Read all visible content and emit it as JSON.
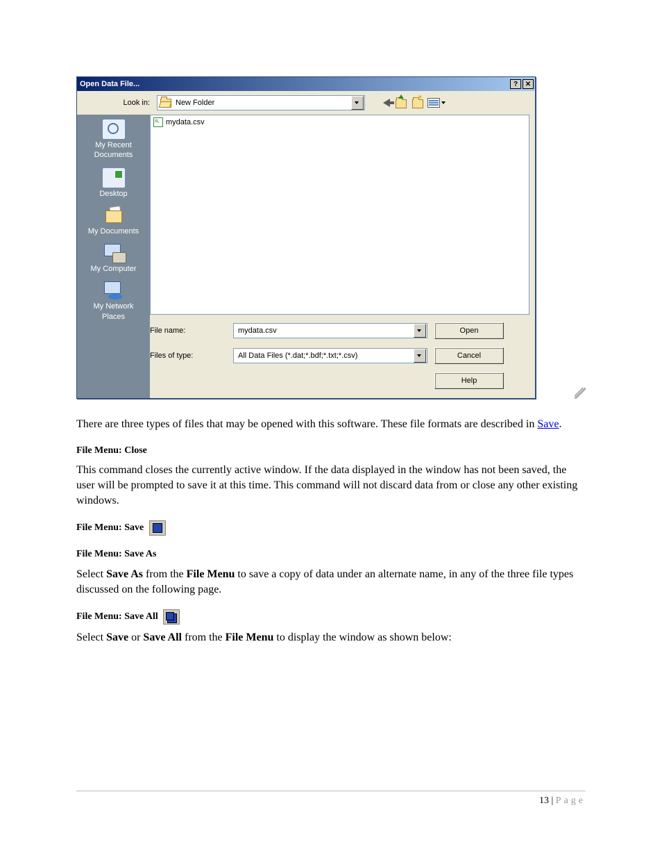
{
  "dialog": {
    "title": "Open Data File...",
    "help_glyph": "?",
    "close_glyph": "✕",
    "lookin_label": "Look in:",
    "lookin_value": "New Folder",
    "places": [
      {
        "label": "My Recent\nDocuments",
        "icon": "docs"
      },
      {
        "label": "Desktop",
        "icon": "desktop"
      },
      {
        "label": "My Documents",
        "icon": "mydocs"
      },
      {
        "label": "My Computer",
        "icon": "computer"
      },
      {
        "label": "My Network\nPlaces",
        "icon": "network"
      }
    ],
    "files": [
      {
        "name": "mydata.csv"
      }
    ],
    "filename_label": "File name:",
    "filename_value": "mydata.csv",
    "filetype_label": "Files of type:",
    "filetype_value": "All Data Files (*.dat;*.bdf;*.txt;*.csv)",
    "buttons": {
      "open": "Open",
      "cancel": "Cancel",
      "help": "Help"
    }
  },
  "doc": {
    "p1a": "There are three types of files that may be opened with this software. These file formats are described in ",
    "p1_link": "Save",
    "p1b": ".",
    "h_close": "File Menu: Close",
    "p_close": "This command closes the currently active window. If the data displayed in the window has not been saved, the user will be prompted to save it at this time. This command will not discard data from or close any other existing windows.",
    "h_save": "File Menu: Save",
    "h_saveas": "File Menu: Save As",
    "p_saveas_a": "Select ",
    "p_saveas_b": "Save As",
    "p_saveas_c": " from the ",
    "p_saveas_d": "File Menu",
    "p_saveas_e": " to save a copy of data under an alternate name, in any of the three file types discussed on the following page.",
    "h_saveall": "File Menu: Save All",
    "p_saveall_a": "Select ",
    "p_saveall_b": "Save",
    "p_saveall_c": " or ",
    "p_saveall_d": "Save All",
    "p_saveall_e": " from the ",
    "p_saveall_f": "File Menu",
    "p_saveall_g": " to display the window as shown below:"
  },
  "footer": {
    "number": "13",
    "sep": " | ",
    "word": "Page"
  }
}
